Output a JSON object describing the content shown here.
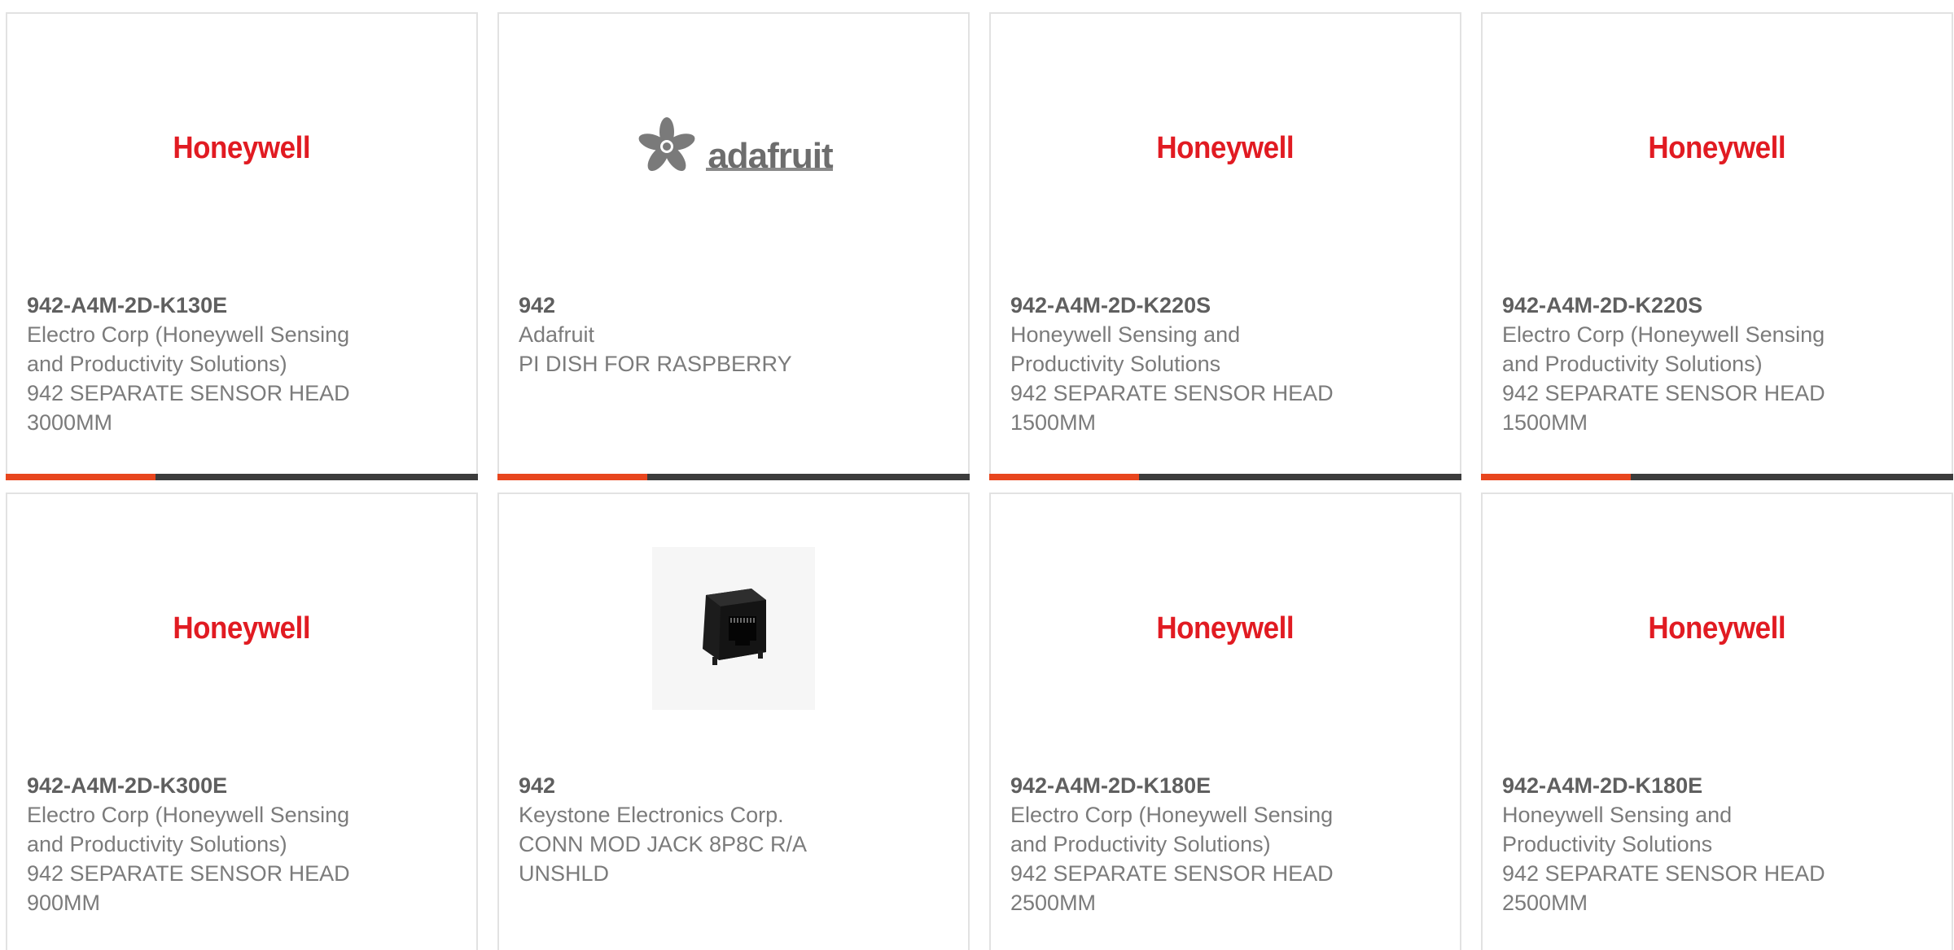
{
  "cards": [
    {
      "logo": "Honeywell",
      "logo_icon": "honeywell-logo",
      "part_number": "942-A4M-2D-K130E",
      "manufacturer_line1": "Electro Corp (Honeywell Sensing",
      "manufacturer_line2": "and Productivity Solutions)",
      "description_line1": "942 SEPARATE SENSOR HEAD",
      "description_line2": "3000MM"
    },
    {
      "logo": "adafruit",
      "logo_icon": "adafruit-logo",
      "part_number": "942",
      "manufacturer_line1": "Adafruit",
      "manufacturer_line2": "",
      "description_line1": "PI DISH FOR RASPBERRY",
      "description_line2": ""
    },
    {
      "logo": "Honeywell",
      "logo_icon": "honeywell-logo",
      "part_number": "942-A4M-2D-K220S",
      "manufacturer_line1": "Honeywell Sensing and",
      "manufacturer_line2": "Productivity Solutions",
      "description_line1": "942 SEPARATE SENSOR HEAD",
      "description_line2": "1500MM"
    },
    {
      "logo": "Honeywell",
      "logo_icon": "honeywell-logo",
      "part_number": "942-A4M-2D-K220S",
      "manufacturer_line1": "Electro Corp (Honeywell Sensing",
      "manufacturer_line2": "and Productivity Solutions)",
      "description_line1": "942 SEPARATE SENSOR HEAD",
      "description_line2": "1500MM"
    },
    {
      "logo": "Honeywell",
      "logo_icon": "honeywell-logo",
      "part_number": "942-A4M-2D-K300E",
      "manufacturer_line1": "Electro Corp (Honeywell Sensing",
      "manufacturer_line2": "and Productivity Solutions)",
      "description_line1": "942 SEPARATE SENSOR HEAD",
      "description_line2": "900MM"
    },
    {
      "logo": "",
      "logo_icon": "modular-jack-photo",
      "part_number": "942",
      "manufacturer_line1": "Keystone Electronics Corp.",
      "manufacturer_line2": "",
      "description_line1": "CONN MOD JACK 8P8C R/A",
      "description_line2": "UNSHLD"
    },
    {
      "logo": "Honeywell",
      "logo_icon": "honeywell-logo",
      "part_number": "942-A4M-2D-K180E",
      "manufacturer_line1": "Electro Corp (Honeywell Sensing",
      "manufacturer_line2": "and Productivity Solutions)",
      "description_line1": "942 SEPARATE SENSOR HEAD",
      "description_line2": "2500MM"
    },
    {
      "logo": "Honeywell",
      "logo_icon": "honeywell-logo",
      "part_number": "942-A4M-2D-K180E",
      "manufacturer_line1": "Honeywell Sensing and",
      "manufacturer_line2": "Productivity Solutions",
      "description_line1": "942 SEPARATE SENSOR HEAD",
      "description_line2": "2500MM"
    }
  ],
  "colors": {
    "honeywell_red": "#e11b22",
    "accent_orange": "#e8461e",
    "bar_dark": "#3c3c3c",
    "text_gray": "#7b7b7b",
    "border_gray": "#e2e2e2"
  }
}
